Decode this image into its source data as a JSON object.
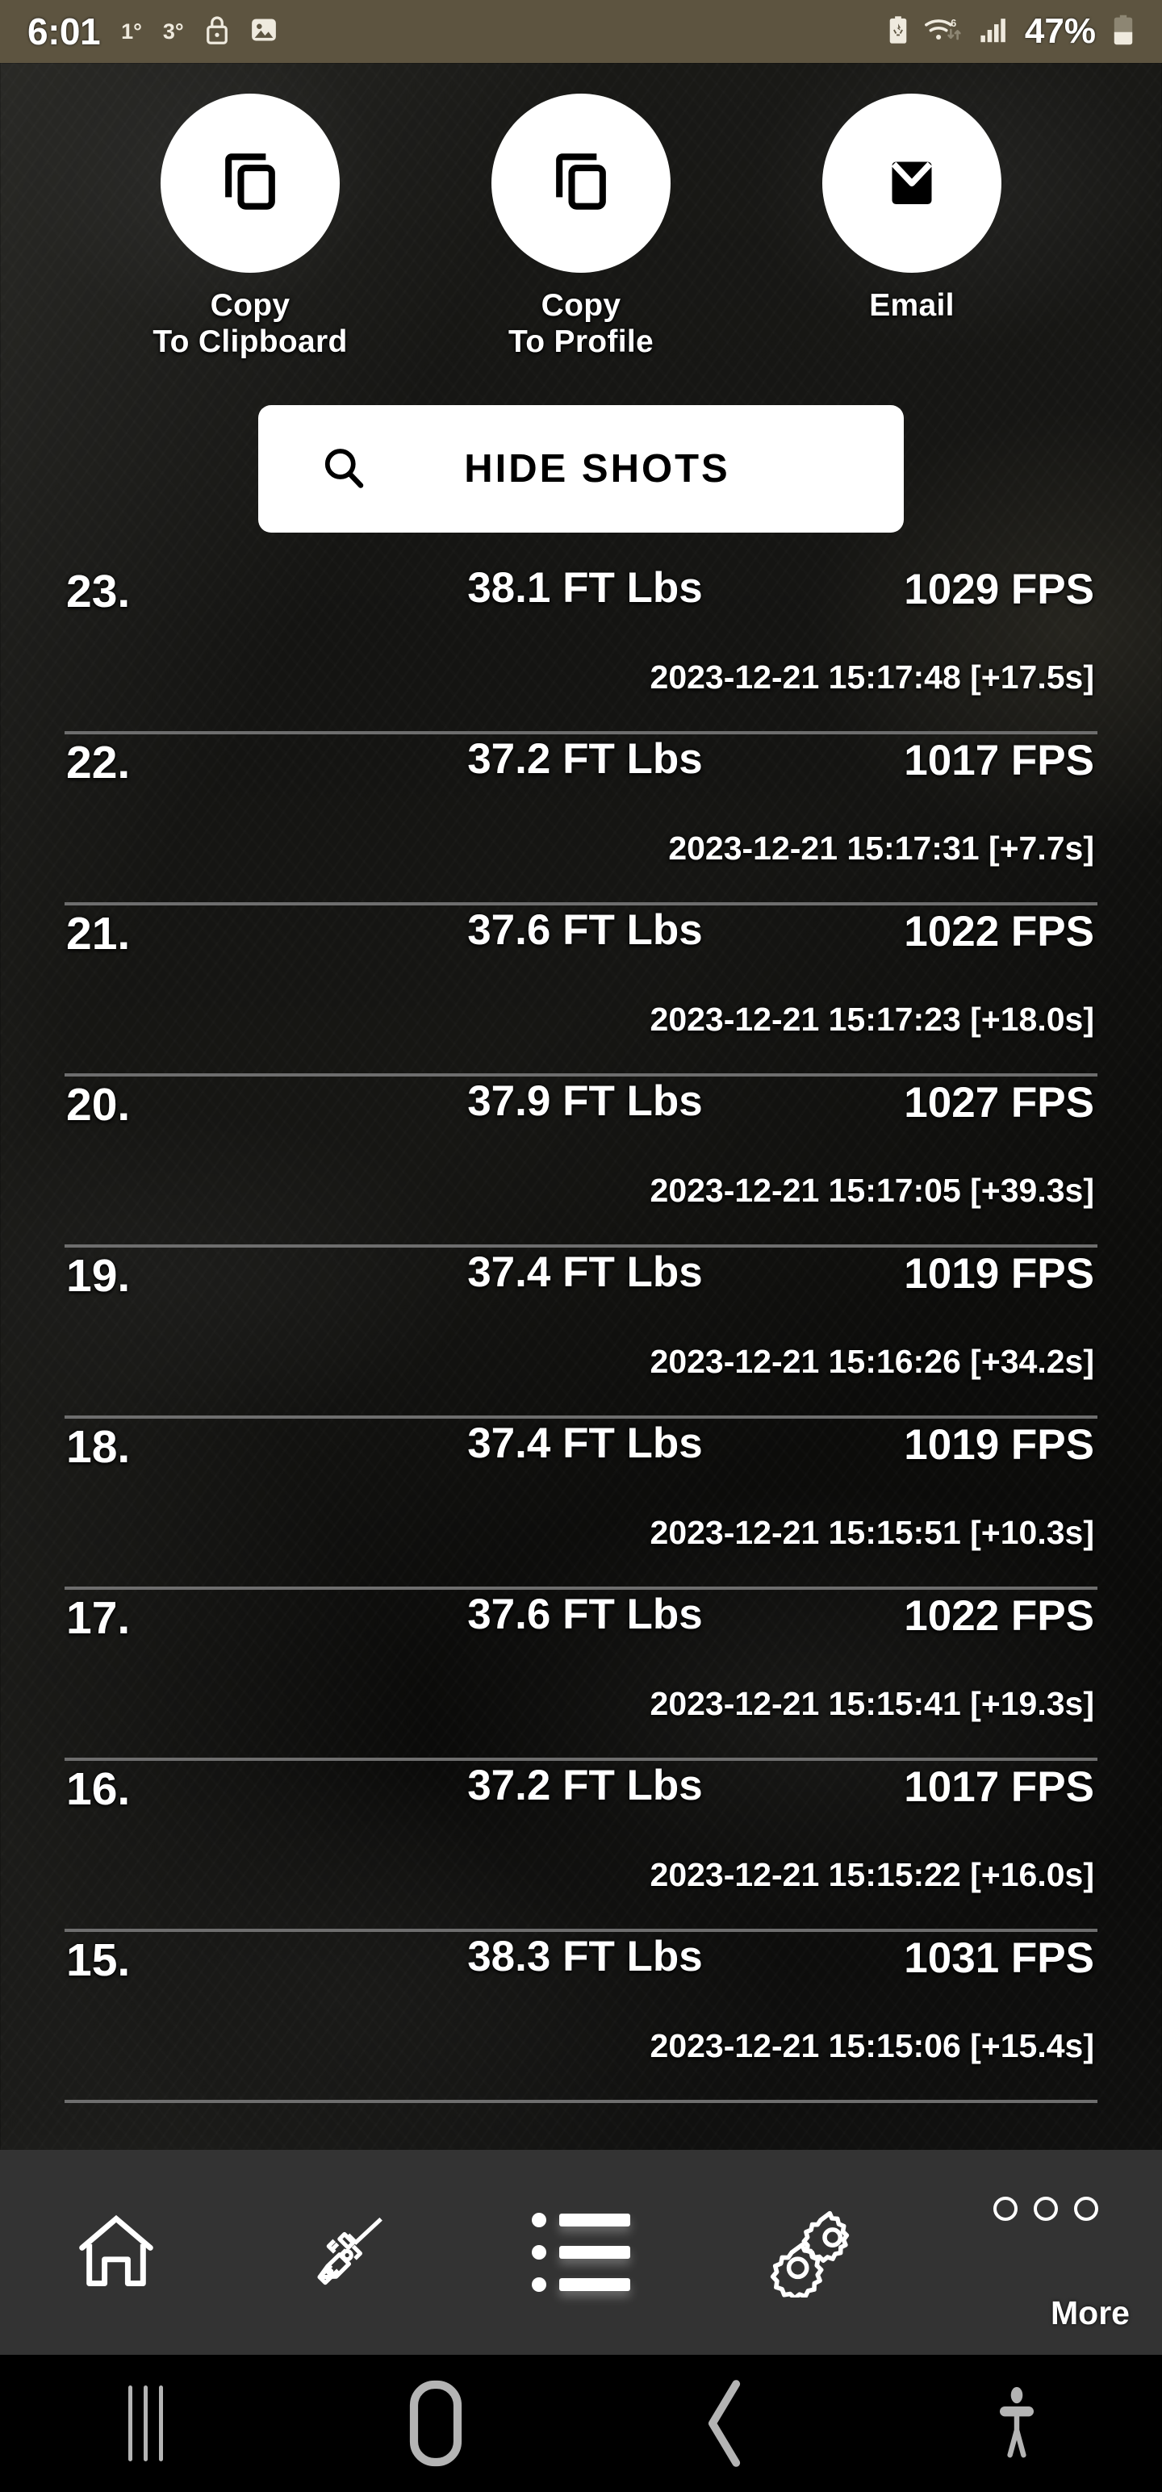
{
  "status_bar": {
    "clock": "6:01",
    "temp_current": "1°",
    "temp_secondary": "3°",
    "battery_percent": "47%",
    "icons": [
      "lock-icon",
      "gallery-icon",
      "battery-saver-icon",
      "wifi-6-icon",
      "cellular-signal-icon",
      "battery-icon"
    ]
  },
  "actions": [
    {
      "label": "Copy\nTo Clipboard",
      "icon": "copy-icon"
    },
    {
      "label": "Copy\nTo Profile",
      "icon": "copy-icon"
    },
    {
      "label": "Email",
      "icon": "envelope-icon"
    }
  ],
  "hide_shots": {
    "label": "HIDE SHOTS",
    "icon": "search-icon"
  },
  "shots": [
    {
      "index": "23.",
      "energy": "38.1 FT Lbs",
      "speed": "1029 FPS",
      "timestamp": "2023-12-21 15:17:48 [+17.5s]"
    },
    {
      "index": "22.",
      "energy": "37.2 FT Lbs",
      "speed": "1017 FPS",
      "timestamp": "2023-12-21 15:17:31 [+7.7s]"
    },
    {
      "index": "21.",
      "energy": "37.6 FT Lbs",
      "speed": "1022 FPS",
      "timestamp": "2023-12-21 15:17:23 [+18.0s]"
    },
    {
      "index": "20.",
      "energy": "37.9 FT Lbs",
      "speed": "1027 FPS",
      "timestamp": "2023-12-21 15:17:05 [+39.3s]"
    },
    {
      "index": "19.",
      "energy": "37.4 FT Lbs",
      "speed": "1019 FPS",
      "timestamp": "2023-12-21 15:16:26 [+34.2s]"
    },
    {
      "index": "18.",
      "energy": "37.4 FT Lbs",
      "speed": "1019 FPS",
      "timestamp": "2023-12-21 15:15:51 [+10.3s]"
    },
    {
      "index": "17.",
      "energy": "37.6 FT Lbs",
      "speed": "1022 FPS",
      "timestamp": "2023-12-21 15:15:41 [+19.3s]"
    },
    {
      "index": "16.",
      "energy": "37.2 FT Lbs",
      "speed": "1017 FPS",
      "timestamp": "2023-12-21 15:15:22 [+16.0s]"
    },
    {
      "index": "15.",
      "energy": "38.3 FT Lbs",
      "speed": "1031 FPS",
      "timestamp": "2023-12-21 15:15:06 [+15.4s]"
    }
  ],
  "bottom_nav": {
    "items": [
      {
        "icon": "home-icon",
        "label": ""
      },
      {
        "icon": "rifle-scope-icon",
        "label": ""
      },
      {
        "icon": "list-icon",
        "label": ""
      },
      {
        "icon": "gears-icon",
        "label": ""
      },
      {
        "icon": "more-dots-icon",
        "label": "More"
      }
    ]
  },
  "system_nav": {
    "items": [
      "recents-icon",
      "home-icon",
      "back-icon",
      "accessibility-icon"
    ]
  },
  "colors": {
    "status_bar_bg": "#5d5440",
    "nav_bg": "#333333",
    "accent_white": "#ffffff",
    "divider": "#6e6e6e",
    "system_nav_bg": "#000000"
  }
}
